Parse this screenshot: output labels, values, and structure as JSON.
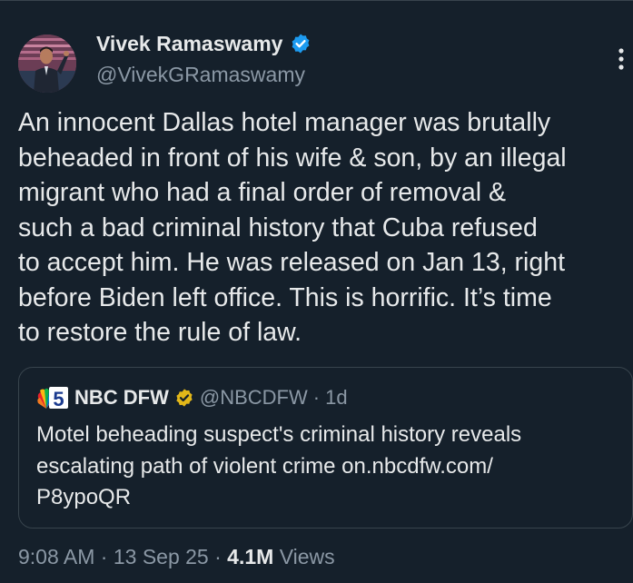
{
  "tweet": {
    "author_name": "Vivek Ramaswamy",
    "author_handle": "@VivekGRamaswamy",
    "text": "An innocent Dallas hotel manager was brutally\nbeheaded in front of his wife & son, by an illegal\nmigrant who had a final order of removal &\nsuch a bad criminal history that Cuba refused\nto accept him. He was released on Jan 13, right\nbefore Biden left office. This is horrific. It’s time\nto restore the rule of law.",
    "time": "9:08 AM",
    "date": "13 Sep 25",
    "views_count": "4.1M",
    "views_label": "Views",
    "separator": "·"
  },
  "quote": {
    "author_name": "NBC DFW",
    "author_handle": "@NBCDFW",
    "separator": "·",
    "age": "1d",
    "text": "Motel beheading suspect's criminal history reveals\nescalating path of violent crime on.nbcdfw.com/\nP8ypoQR",
    "logo_number": "5"
  },
  "icons": {
    "verified_badge": "verified-blue-badge-icon",
    "gold_badge": "verified-gold-badge-icon",
    "more": "more-vertical-icon",
    "quote_logo": "nbc-peacock-5-logo"
  },
  "colors": {
    "background": "#15202b",
    "text": "#e7e9ea",
    "secondary": "#8b98a5",
    "verified_blue": "#1d9bf0",
    "verified_gold": "#e2b719",
    "border": "#38444d"
  }
}
